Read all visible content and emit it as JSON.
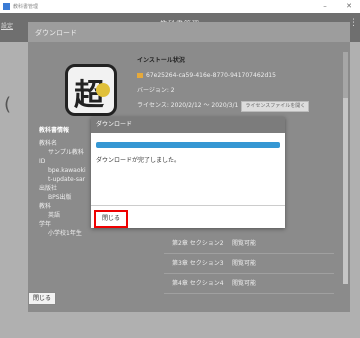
{
  "window": {
    "title": "教科書管理",
    "app_title": "教科書管理",
    "menu": "設定",
    "minimize": "–",
    "close": "✕"
  },
  "download_panel": {
    "title": "ダウンロード",
    "close_label": "閉じる"
  },
  "install_status": {
    "heading": "インストール状況",
    "guid": "67e25264-ca59-416e-8770-941707462d15",
    "version": "バージョン: 2",
    "license": "ライセンス: 2020/2/12 ～ 2020/3/1",
    "license_button": "ライセンスファイルを開く"
  },
  "book_info": {
    "heading": "教科書情報",
    "name_label": "教科名",
    "name_value": "サンプル教科",
    "id_label": "ID",
    "id_value_1": "bpe.kawaoki",
    "id_value_2": "t-update-sar",
    "publisher_label": "出版社",
    "publisher_value": "BPS出版",
    "subject_label": "教科",
    "subject_value": "英語",
    "grade_label": "学年",
    "grade_value": "小学校1年生"
  },
  "sections": [
    {
      "name": "第2章 セクション2",
      "status": "閲覧可能"
    },
    {
      "name": "第3章 セクション3",
      "status": "閲覧可能"
    },
    {
      "name": "第4章 セクション4",
      "status": "閲覧可能"
    }
  ],
  "dialog": {
    "title": "ダウンロード",
    "message": "ダウンロードが完了しました。",
    "close_label": "閉じる",
    "progress": 1.0
  },
  "colors": {
    "progress": "#3597d3",
    "highlight": "#e00000"
  }
}
